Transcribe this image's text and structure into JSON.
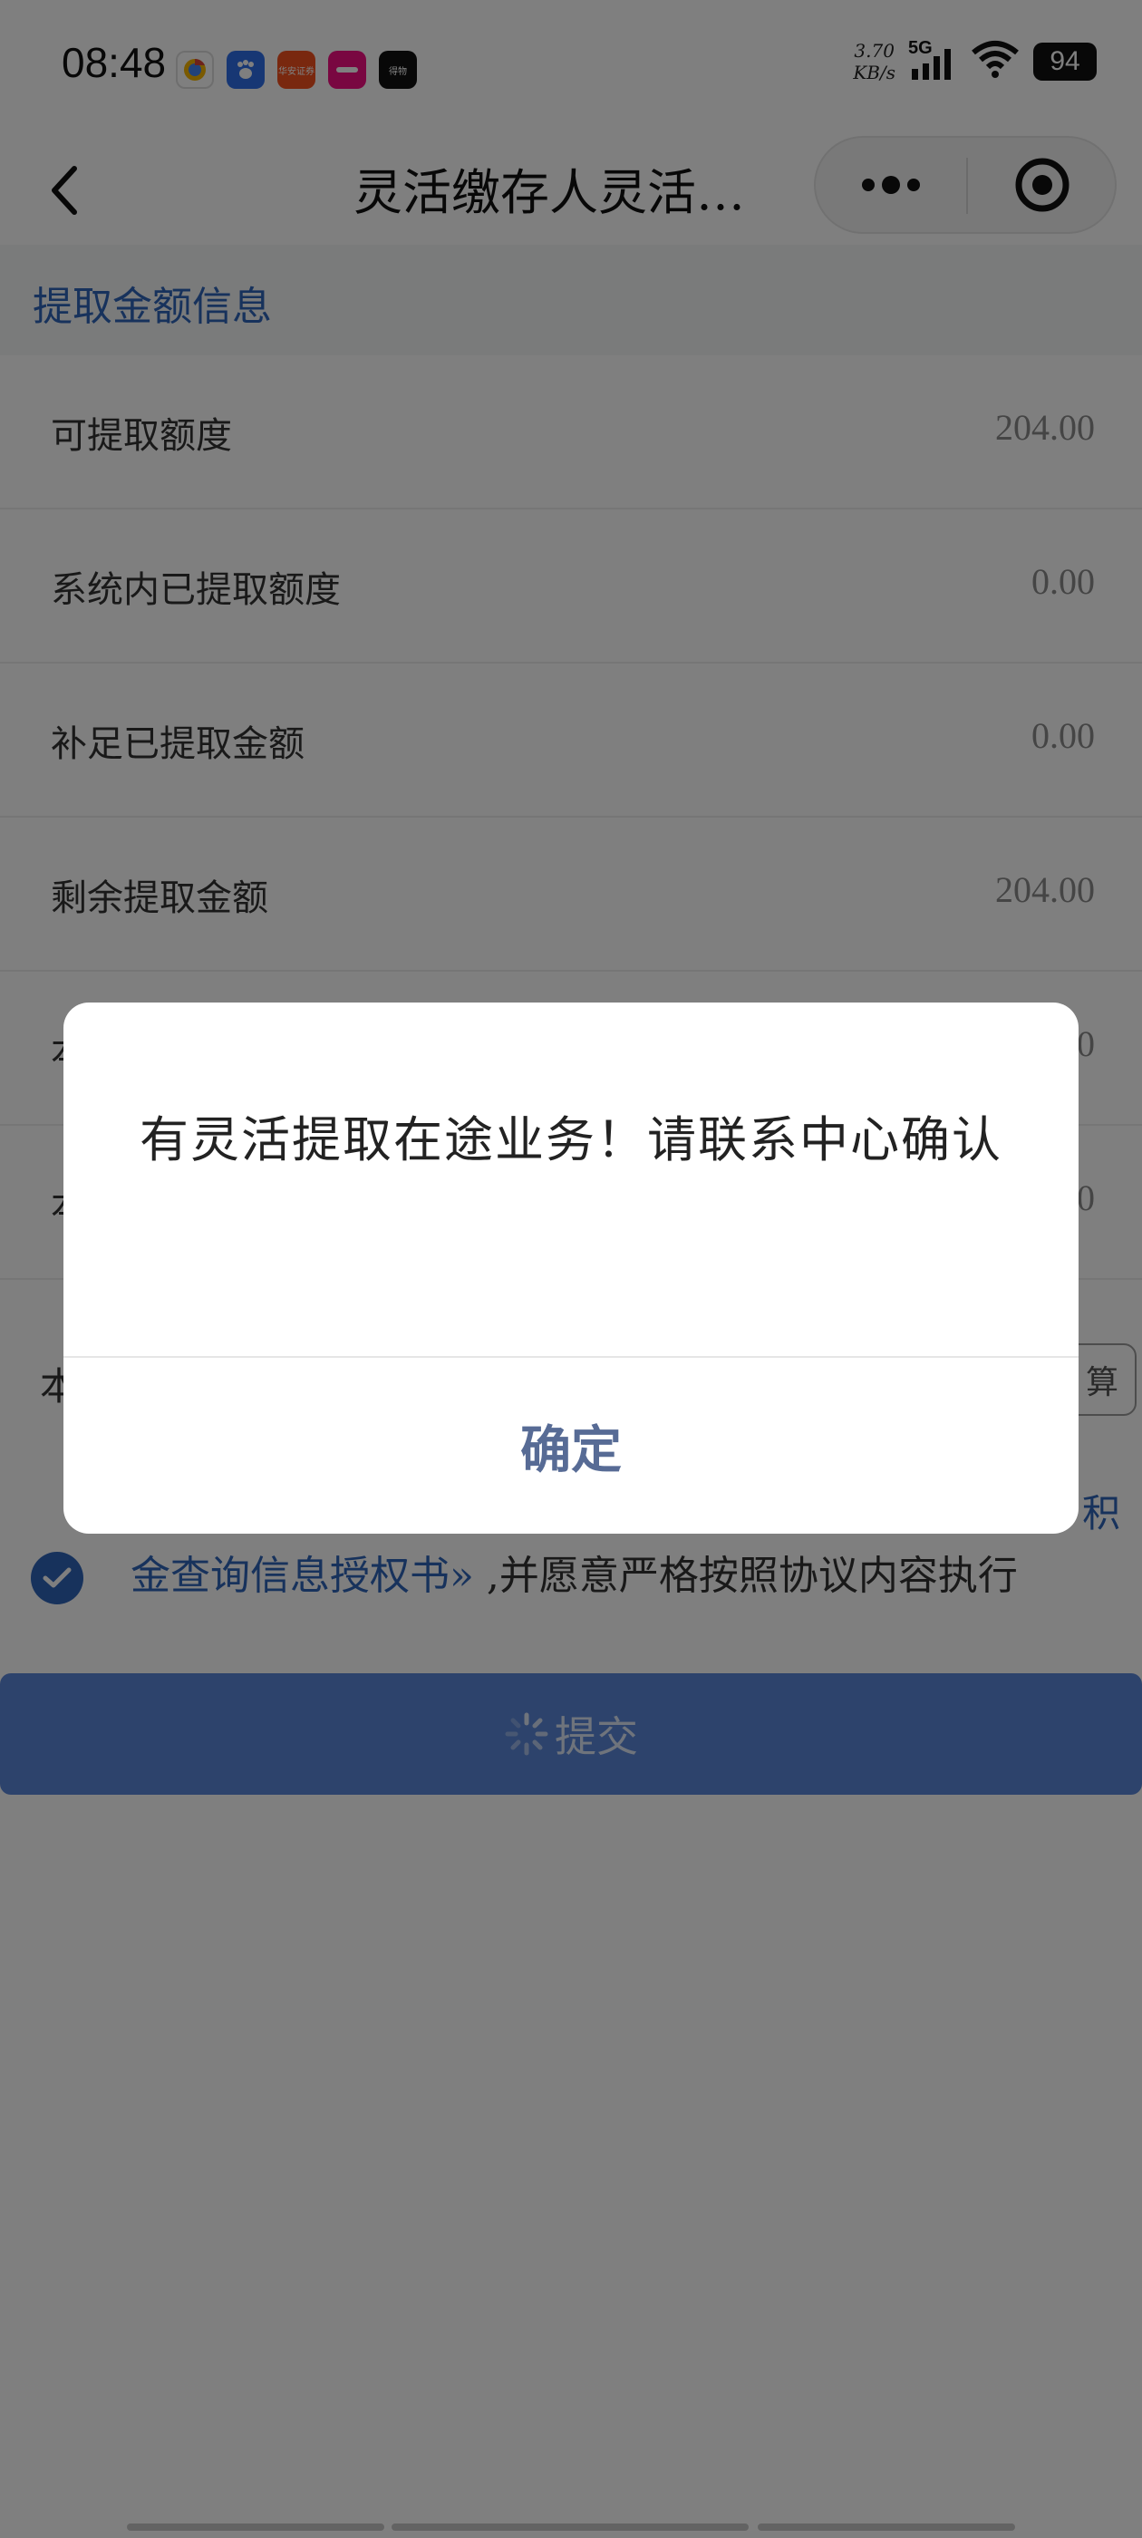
{
  "status_bar": {
    "time": "08:48",
    "apps": [
      {
        "icon": "chrome-like-app-icon",
        "label": "",
        "color": "#ffffff"
      },
      {
        "icon": "baidu-paw-icon",
        "label": "",
        "color": "#2f6fe8"
      },
      {
        "icon": "securities-app-icon",
        "label": "华安证券",
        "color": "#f2501f"
      },
      {
        "icon": "pink-app-icon",
        "label": "",
        "color": "#f20f82"
      },
      {
        "icon": "dewu-app-icon",
        "label": "得物",
        "color": "#111111"
      }
    ],
    "net_speed_value": "3.70",
    "net_speed_unit": "KB/s",
    "network": "5G",
    "battery": "94"
  },
  "nav": {
    "title": "灵活缴存人灵活…"
  },
  "section": {
    "title": "提取金额信息"
  },
  "rows": [
    {
      "label": "可提取额度",
      "value": "204.00"
    },
    {
      "label": "系统内已提取额度",
      "value": "0.00"
    },
    {
      "label": "补足已提取金额",
      "value": "0.00"
    },
    {
      "label": "剩余提取金额",
      "value": "204.00"
    },
    {
      "label": "本",
      "value": "0"
    },
    {
      "label": "本",
      "value": "0"
    }
  ],
  "partial": {
    "label": "本",
    "calc_button": "算",
    "link_tail": "积"
  },
  "agreement": {
    "link_text": "金查询信息授权书»",
    "rest_text": " ,并愿意严格按照协议内容执行"
  },
  "submit": {
    "label": "提交"
  },
  "dialog": {
    "message": "有灵活提取在途业务！请联系中心确认",
    "confirm": "确定"
  },
  "colors": {
    "accent": "#2e64b8",
    "dialog_button": "#576b95"
  }
}
